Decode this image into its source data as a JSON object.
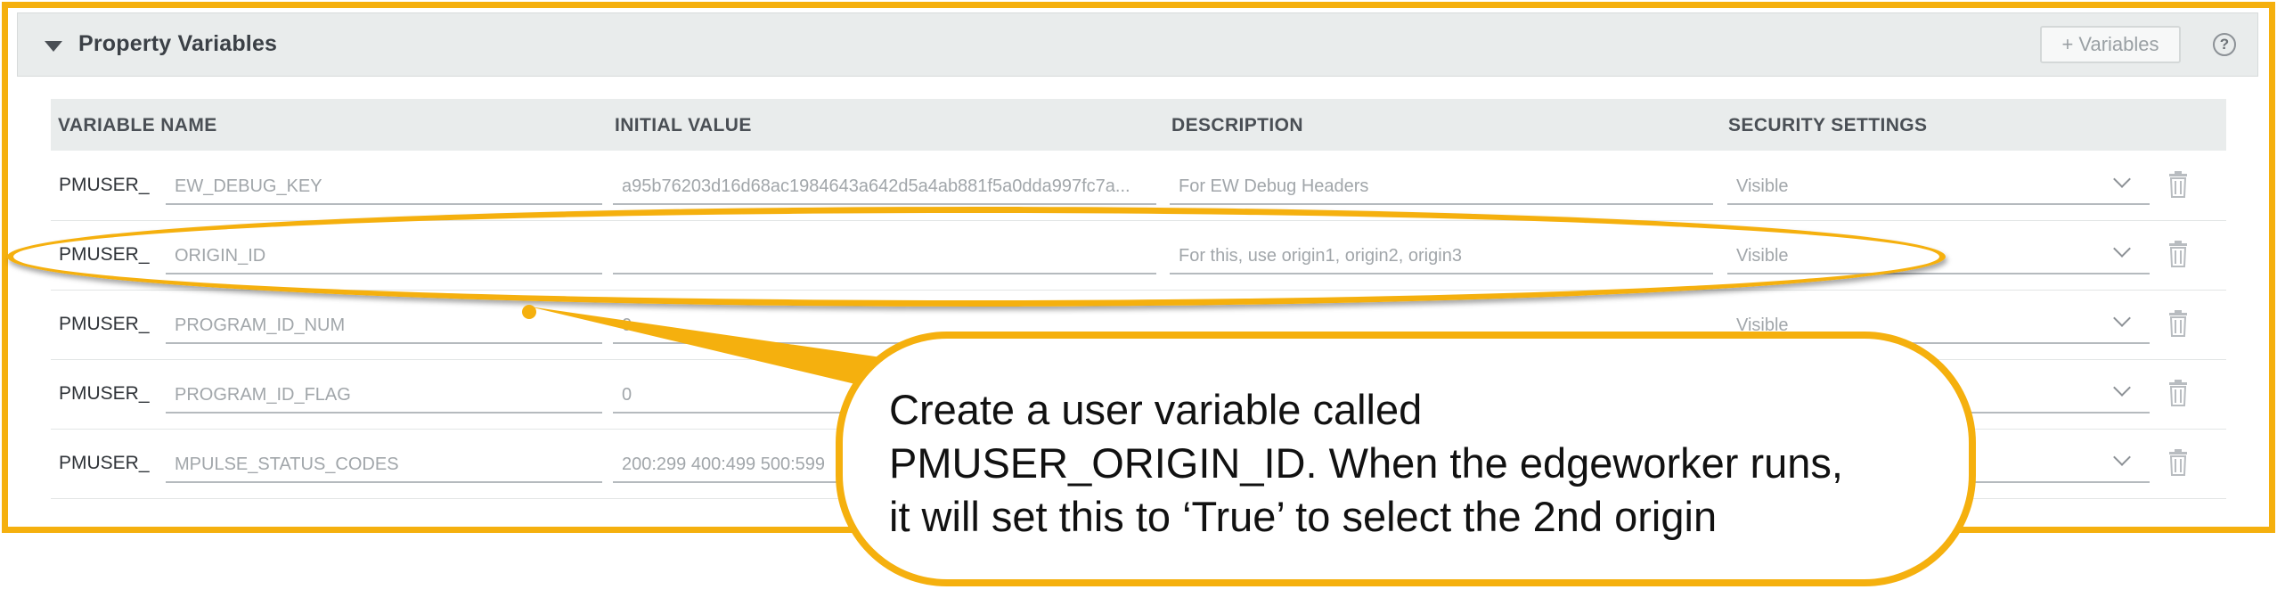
{
  "panel": {
    "title": "Property Variables",
    "add_button": "+ Variables",
    "help_icon": "question-circle-icon",
    "caret_icon": "caret-down-icon"
  },
  "columns": {
    "name": "VARIABLE NAME",
    "initial": "INITIAL VALUE",
    "description": "DESCRIPTION",
    "security": "SECURITY SETTINGS"
  },
  "rows": [
    {
      "prefix": "PMUSER_",
      "name": "EW_DEBUG_KEY",
      "initial": "a95b76203d16d68ac1984643a642d5a4ab881f5a0dda997fc7a...",
      "description": "For EW Debug Headers",
      "security": "Visible"
    },
    {
      "prefix": "PMUSER_",
      "name": "ORIGIN_ID",
      "initial": "",
      "description": "For this, use origin1, origin2, origin3",
      "security": "Visible"
    },
    {
      "prefix": "PMUSER_",
      "name": "PROGRAM_ID_NUM",
      "initial": "0",
      "description": "",
      "security": "Visible"
    },
    {
      "prefix": "PMUSER_",
      "name": "PROGRAM_ID_FLAG",
      "initial": "0",
      "description": "",
      "security": ""
    },
    {
      "prefix": "PMUSER_",
      "name": "MPULSE_STATUS_CODES",
      "initial": "200:299 400:499 500:599",
      "description": "",
      "security": ""
    }
  ],
  "callout": {
    "line1": "Create a user variable called",
    "line2": "PMUSER_ORIGIN_ID. When the edgeworker runs,",
    "line3": "it will set this to ‘True’ to select the 2nd origin"
  },
  "colors": {
    "highlight": "#f5b00e",
    "header_bg": "#e9ecec"
  }
}
